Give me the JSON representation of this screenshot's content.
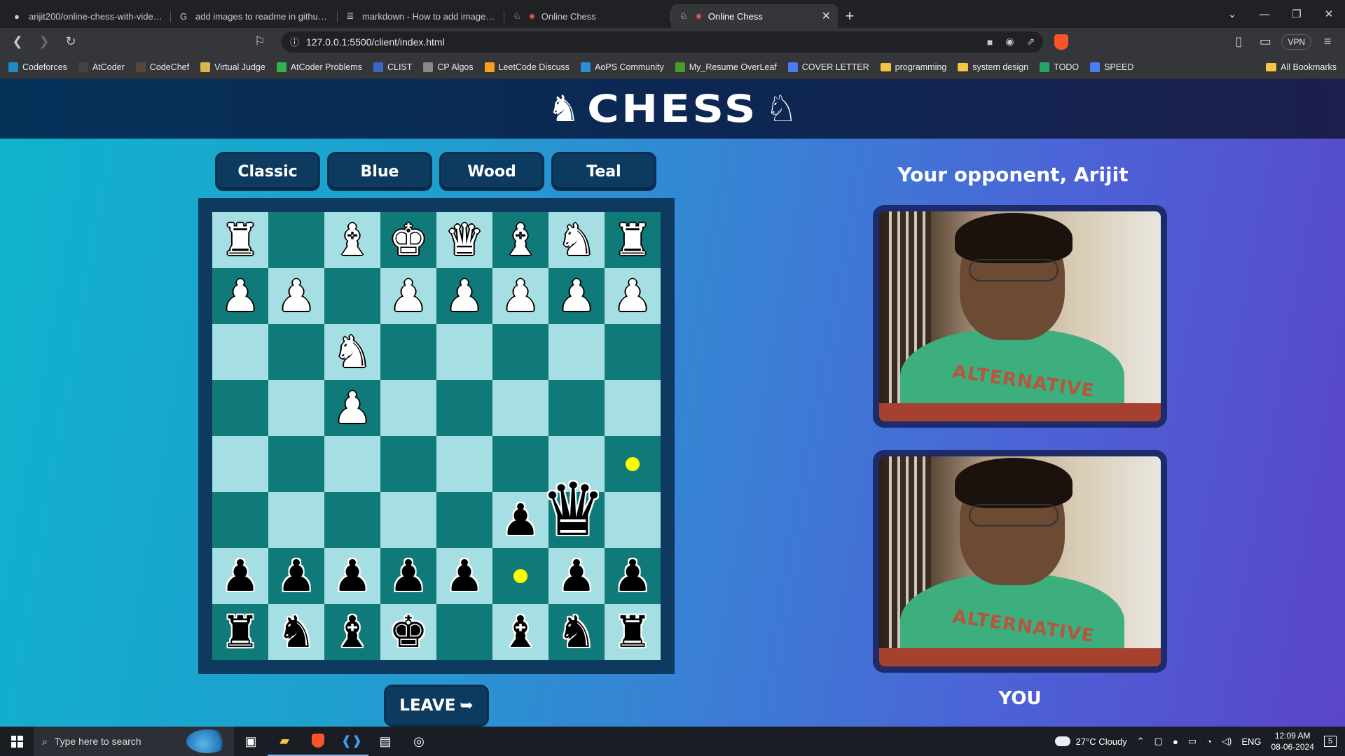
{
  "browser": {
    "tabs": [
      {
        "title": "arijit200/online-chess-with-video-ch",
        "icon": "github-icon",
        "active": false
      },
      {
        "title": "add images to readme in github - Go",
        "icon": "google-icon",
        "active": false
      },
      {
        "title": "markdown - How to add images to R",
        "icon": "stackoverflow-icon",
        "active": false
      },
      {
        "title": "Online Chess",
        "icon": "chess-knight-icon",
        "active": false
      },
      {
        "title": "Online Chess",
        "icon": "chess-knight-icon",
        "active": true
      }
    ],
    "new_tab": "+",
    "url": "127.0.0.1:5500/client/index.html",
    "vpn_label": "VPN",
    "bookmarks": [
      {
        "label": "Codeforces",
        "color": "#1f8acb"
      },
      {
        "label": "AtCoder",
        "color": "#444"
      },
      {
        "label": "CodeChef",
        "color": "#5b4638"
      },
      {
        "label": "Virtual Judge",
        "color": "#d6b84b"
      },
      {
        "label": "AtCoder Problems",
        "color": "#2fb34a"
      },
      {
        "label": "CLIST",
        "color": "#3b66c4"
      },
      {
        "label": "CP Algos",
        "color": "#888"
      },
      {
        "label": "LeetCode Discuss",
        "color": "#f89f1b"
      },
      {
        "label": "AoPS Community",
        "color": "#2a8fd8"
      },
      {
        "label": "My_Resume OverLeaf",
        "color": "#4c9a2a"
      },
      {
        "label": "COVER LETTER",
        "color": "#4a7cf7"
      },
      {
        "label": "programming",
        "color": "folder"
      },
      {
        "label": "system design",
        "color": "folder"
      },
      {
        "label": "TODO",
        "color": "#23a566"
      },
      {
        "label": "SPEED",
        "color": "#4a7cf7"
      }
    ],
    "all_bookmarks": "All Bookmarks"
  },
  "app": {
    "title": "CHESS",
    "themes": [
      "Classic",
      "Blue",
      "Wood",
      "Teal"
    ],
    "leave_label": "LEAVE",
    "leave_arrow": "➥",
    "opponent_label": "Your opponent, Arijit",
    "you_label": "YOU",
    "shirt_text": "ALTERNATIVE",
    "board_theme": {
      "light": "#a6dfe3",
      "dark": "#0f7a78"
    },
    "board": [
      [
        "wR",
        "",
        "wB",
        "wK",
        "wQ",
        "wB",
        "wN",
        "wR"
      ],
      [
        "wP",
        "wP",
        "",
        "wP",
        "wP",
        "wP",
        "wP",
        "wP"
      ],
      [
        "",
        "",
        "wN",
        "",
        "",
        "",
        "",
        ""
      ],
      [
        "",
        "",
        "wP",
        "",
        "",
        "",
        "",
        ""
      ],
      [
        "",
        "",
        "",
        "",
        "",
        "",
        "",
        "dot"
      ],
      [
        "",
        "",
        "",
        "",
        "",
        "bP",
        "bQ*",
        ""
      ],
      [
        "bP",
        "bP",
        "bP",
        "bP",
        "bP",
        "dot",
        "bP",
        "bP"
      ],
      [
        "bR",
        "bN",
        "bB",
        "bK",
        "",
        "bB",
        "bN",
        "bR"
      ]
    ]
  },
  "taskbar": {
    "search_placeholder": "Type here to search",
    "weather": "27°C  Cloudy",
    "language": "ENG",
    "time": "12:09 AM",
    "date": "08-06-2024",
    "notifications": "5"
  }
}
